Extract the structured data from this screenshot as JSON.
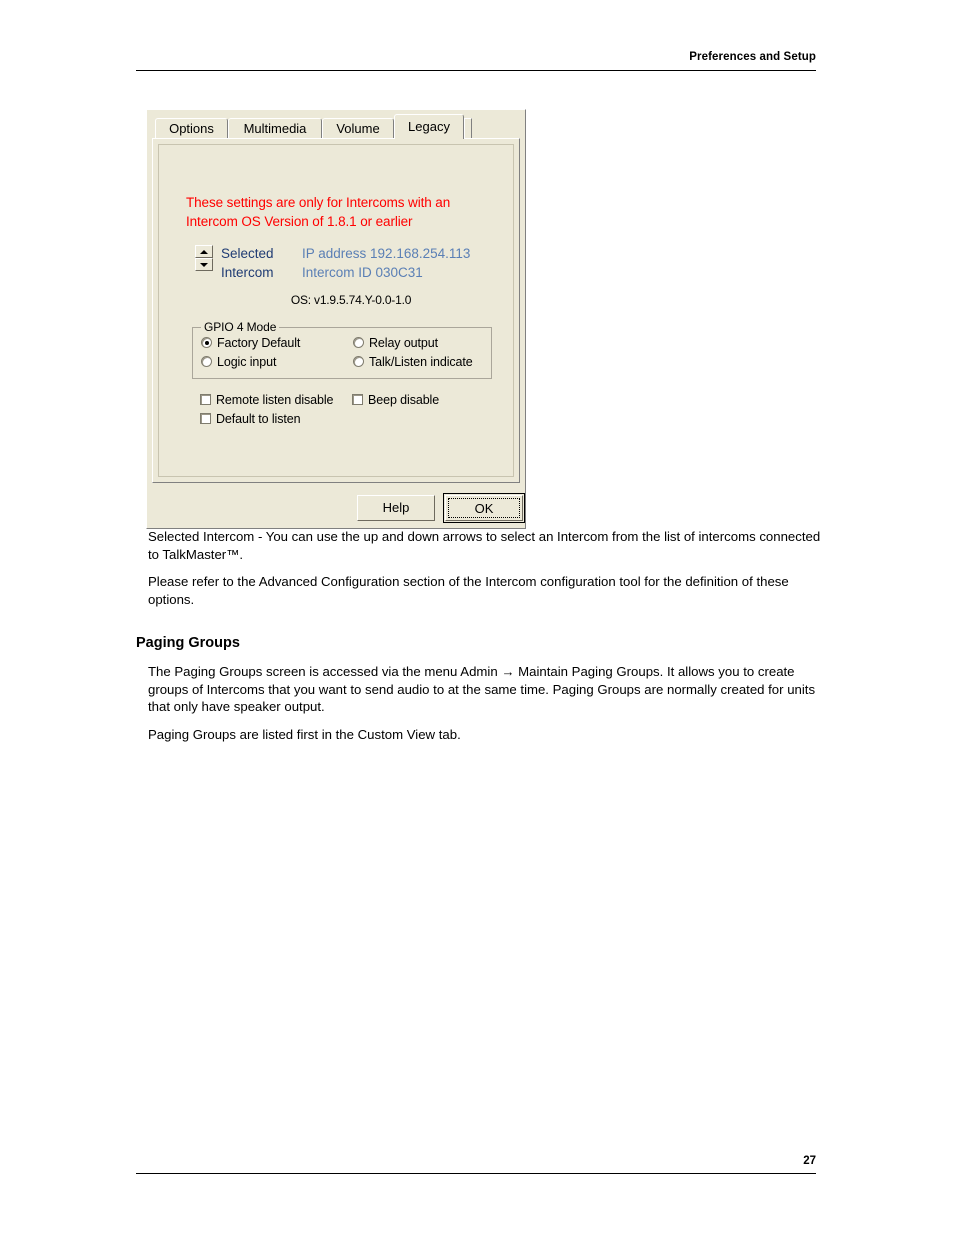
{
  "page": {
    "header_title": "Preferences and Setup",
    "page_number": "27"
  },
  "dialog": {
    "tabs": [
      {
        "label": "Options",
        "active": false
      },
      {
        "label": "Multimedia",
        "active": false
      },
      {
        "label": "Volume",
        "active": false
      },
      {
        "label": "Legacy",
        "active": true
      }
    ],
    "warning_line1": "These settings are only for Intercoms with an",
    "warning_line2": "Intercom OS Version of 1.8.1 or earlier",
    "spinner": {
      "up_icon": "triangle-up-icon",
      "down_icon": "triangle-down-icon"
    },
    "selected_label_line1": "Selected",
    "selected_label_line2": "Intercom",
    "ip_address": "IP address 192.168.254.113",
    "intercom_id": "Intercom ID 030C31",
    "os_version": "OS:  v1.9.5.74.Y-0.0-1.0",
    "gpio_group": {
      "legend": "GPIO 4  Mode",
      "options": [
        {
          "label": "Factory Default",
          "selected": true
        },
        {
          "label": "Logic input",
          "selected": false
        },
        {
          "label": "Relay output",
          "selected": false
        },
        {
          "label": "Talk/Listen indicate",
          "selected": false
        }
      ]
    },
    "checkboxes": [
      {
        "label": "Remote listen disable",
        "checked": false
      },
      {
        "label": "Beep disable",
        "checked": false
      },
      {
        "label": "Default to listen",
        "checked": false
      }
    ],
    "buttons": {
      "help": "Help",
      "ok": "OK"
    },
    "colors": {
      "face": "#ece9d8",
      "warning_red": "#ff0000",
      "label_blue": "#1f3b73",
      "value_blue": "#5a7fb5"
    }
  },
  "body": {
    "para1": "Selected Intercom - You can use the up and down arrows to select an Intercom from the list of intercoms connected to TalkMaster™.",
    "para2": "Please refer to the Advanced Configuration section of the Intercom configuration tool for the definition of these options.",
    "section_heading": "Paging Groups",
    "para3": "The Paging Groups screen is accessed via the menu Admin → Maintain Paging Groups. It allows you to create groups of Intercoms that you want to send audio to at the same time. Paging Groups are normally created for units that only have speaker output.",
    "para4": "Paging Groups are listed first in the Custom View tab."
  }
}
